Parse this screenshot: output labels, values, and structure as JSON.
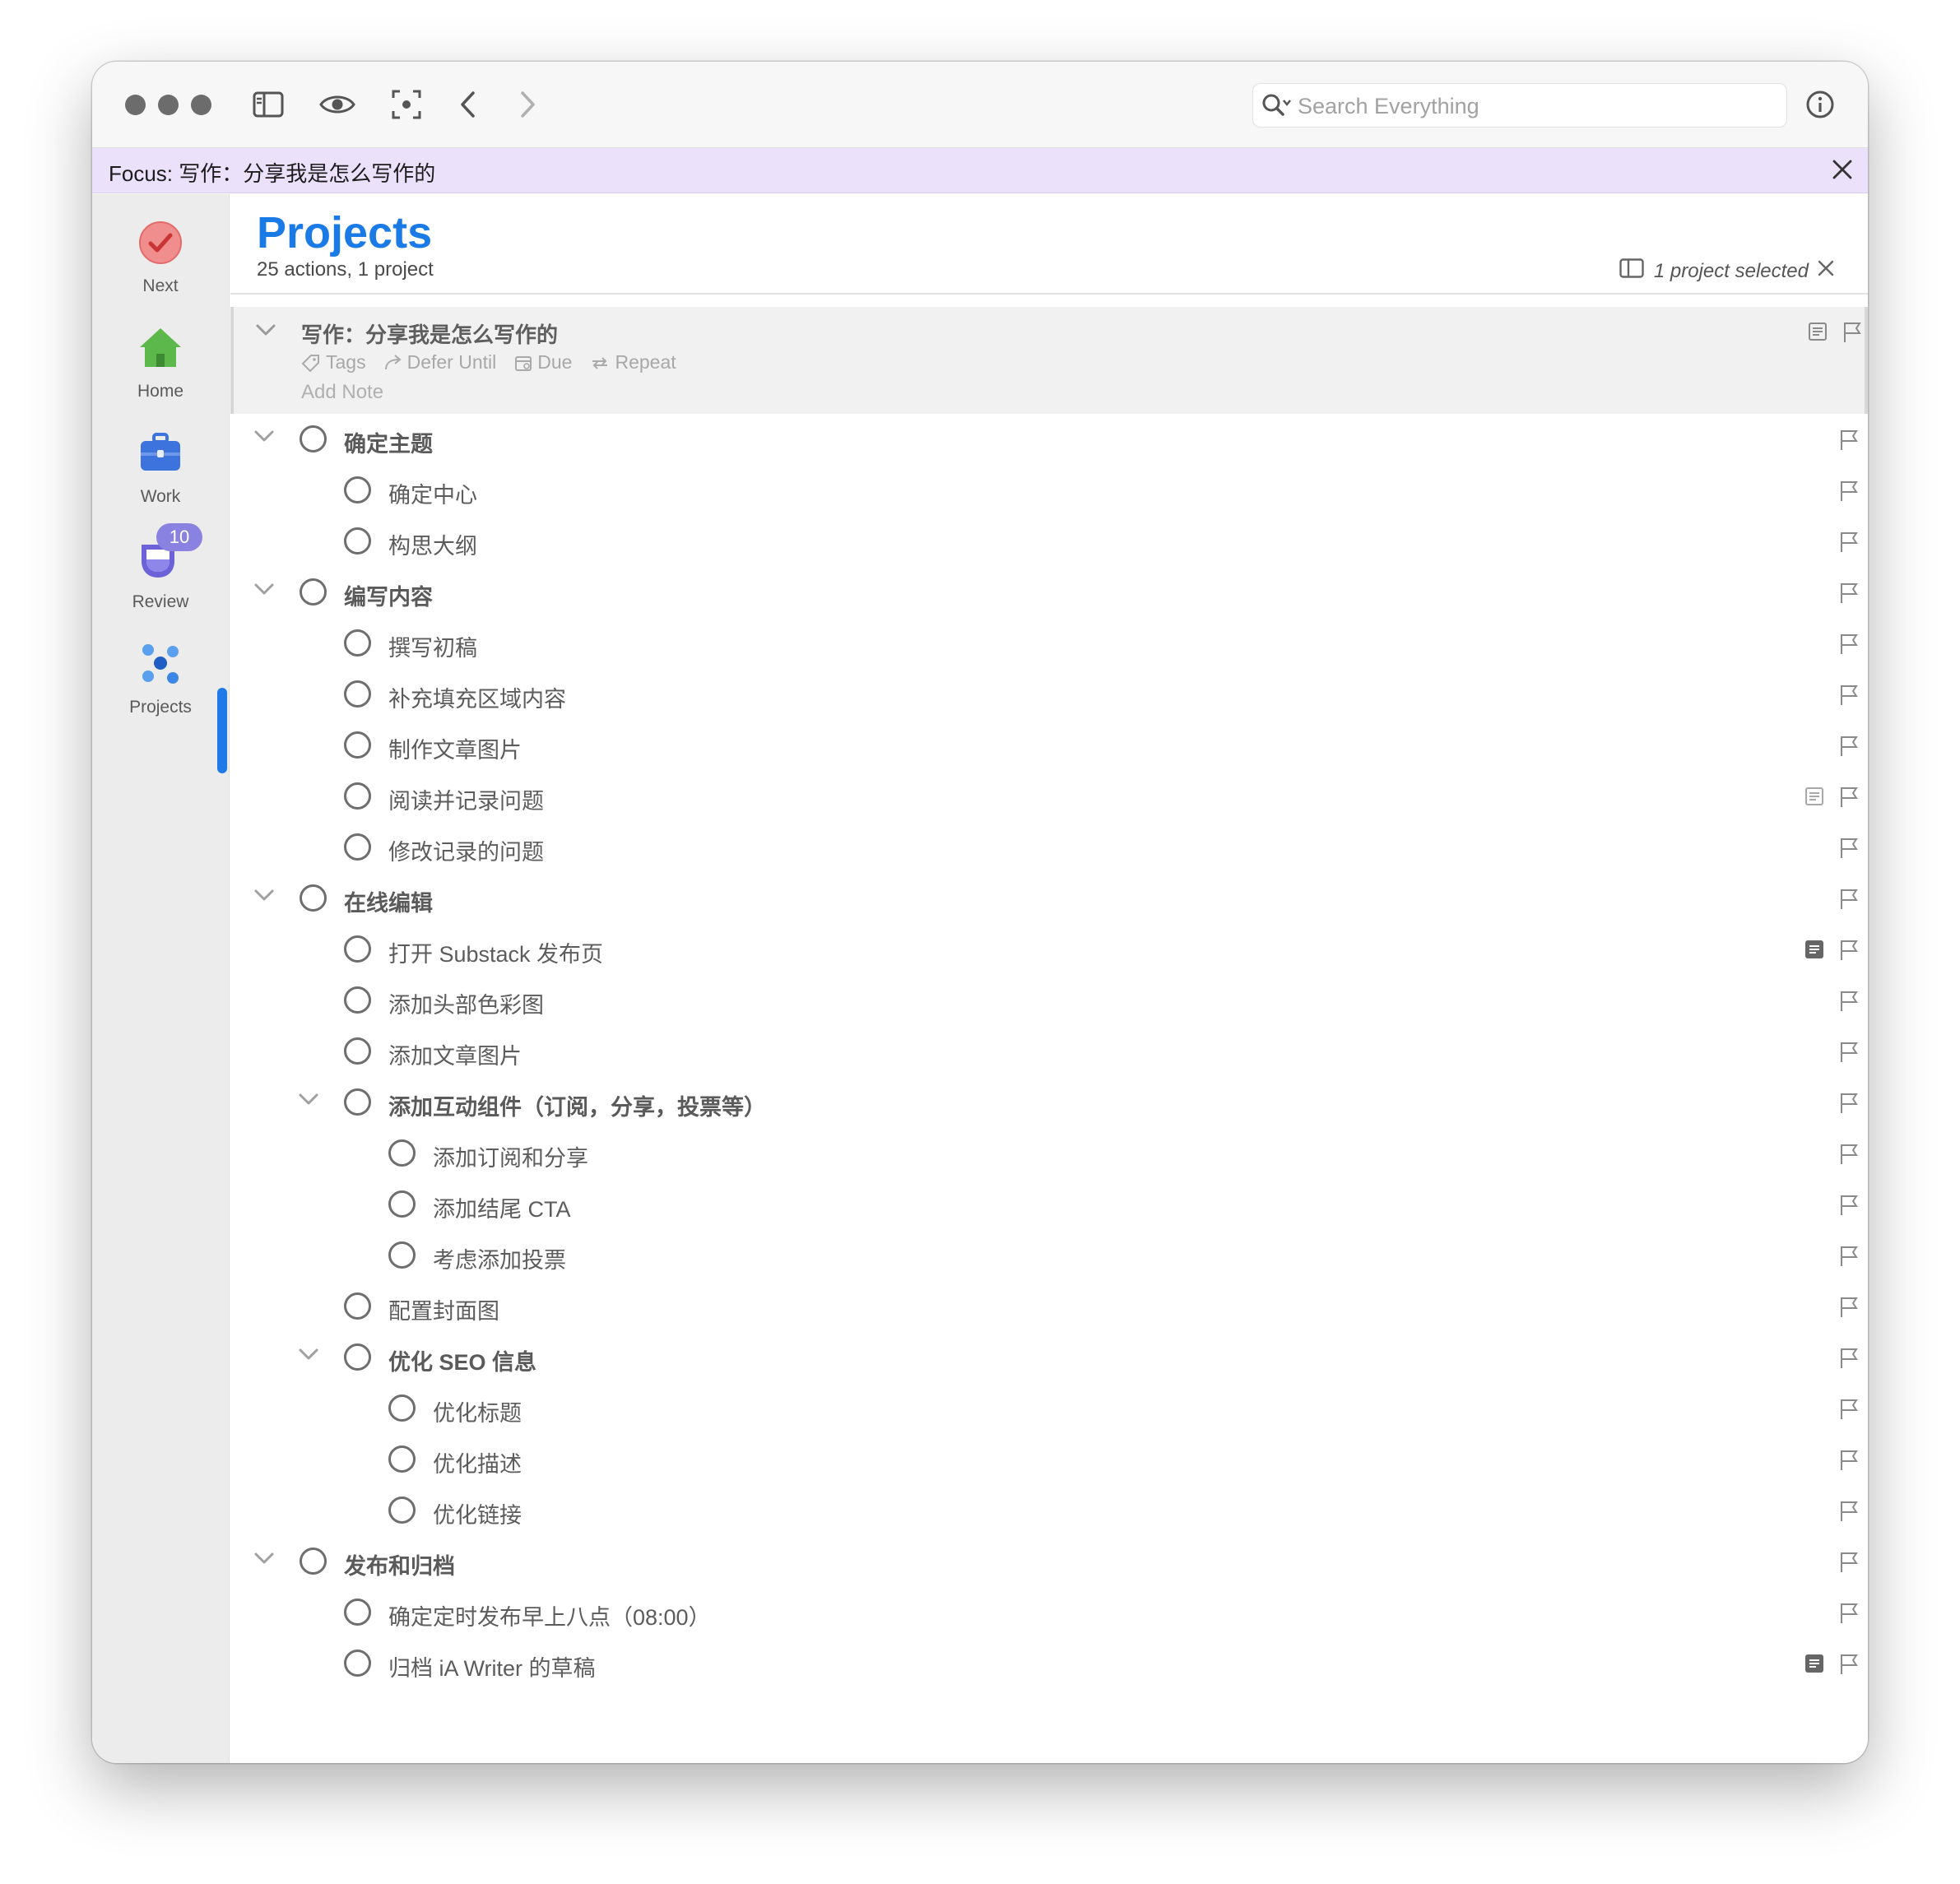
{
  "toolbar": {
    "search_placeholder": "Search Everything",
    "icons": [
      "sidebar-toggle-icon",
      "eye-icon",
      "focus-icon",
      "chevron-left-icon",
      "chevron-right-icon",
      "info-icon"
    ]
  },
  "focus_bar": {
    "text": "Focus: 写作：分享我是怎么写作的"
  },
  "sidebar": {
    "items": [
      {
        "label": "Next",
        "icon": "check-circle-icon",
        "color": "#e05b5b"
      },
      {
        "label": "Home",
        "icon": "house-icon",
        "color": "#5cb84a"
      },
      {
        "label": "Work",
        "icon": "briefcase-icon",
        "color": "#3c73dc"
      },
      {
        "label": "Review",
        "icon": "review-cup-icon",
        "color": "#6c63d8",
        "badge": "10"
      },
      {
        "label": "Projects",
        "icon": "projects-dots-icon",
        "color": "#3c86e6",
        "selected": true
      }
    ]
  },
  "header": {
    "title": "Projects",
    "subtitle": "25 actions, 1 project",
    "selection_text": "1 project selected"
  },
  "project": {
    "title": "写作：分享我是怎么写作的",
    "meta": {
      "tags": "Tags",
      "defer": "Defer Until",
      "due": "Due",
      "repeat": "Repeat"
    },
    "note_placeholder": "Add Note"
  },
  "accent": "#1a7ae6",
  "rows": [
    {
      "label": "确定主题",
      "level": 0,
      "group": true
    },
    {
      "label": "确定中心",
      "level": 1
    },
    {
      "label": "构思大纲",
      "level": 1
    },
    {
      "label": "编写内容",
      "level": 0,
      "group": true
    },
    {
      "label": "撰写初稿",
      "level": 1
    },
    {
      "label": "补充填充区域内容",
      "level": 1
    },
    {
      "label": "制作文章图片",
      "level": 1
    },
    {
      "label": "阅读并记录问题",
      "level": 1,
      "note": "outline"
    },
    {
      "label": "修改记录的问题",
      "level": 1
    },
    {
      "label": "在线编辑",
      "level": 0,
      "group": true
    },
    {
      "label": "打开 Substack 发布页",
      "level": 1,
      "note": "filled"
    },
    {
      "label": "添加头部色彩图",
      "level": 1
    },
    {
      "label": "添加文章图片",
      "level": 1
    },
    {
      "label": "添加互动组件（订阅，分享，投票等）",
      "level": 1,
      "group": true
    },
    {
      "label": "添加订阅和分享",
      "level": 2
    },
    {
      "label": "添加结尾 CTA",
      "level": 2
    },
    {
      "label": "考虑添加投票",
      "level": 2
    },
    {
      "label": "配置封面图",
      "level": 1
    },
    {
      "label": "优化 SEO 信息",
      "level": 1,
      "group": true
    },
    {
      "label": "优化标题",
      "level": 2
    },
    {
      "label": "优化描述",
      "level": 2
    },
    {
      "label": "优化链接",
      "level": 2
    },
    {
      "label": "发布和归档",
      "level": 0,
      "group": true
    },
    {
      "label": "确定定时发布早上八点（08:00）",
      "level": 1
    },
    {
      "label": "归档 iA Writer 的草稿",
      "level": 1,
      "note": "filled"
    }
  ]
}
